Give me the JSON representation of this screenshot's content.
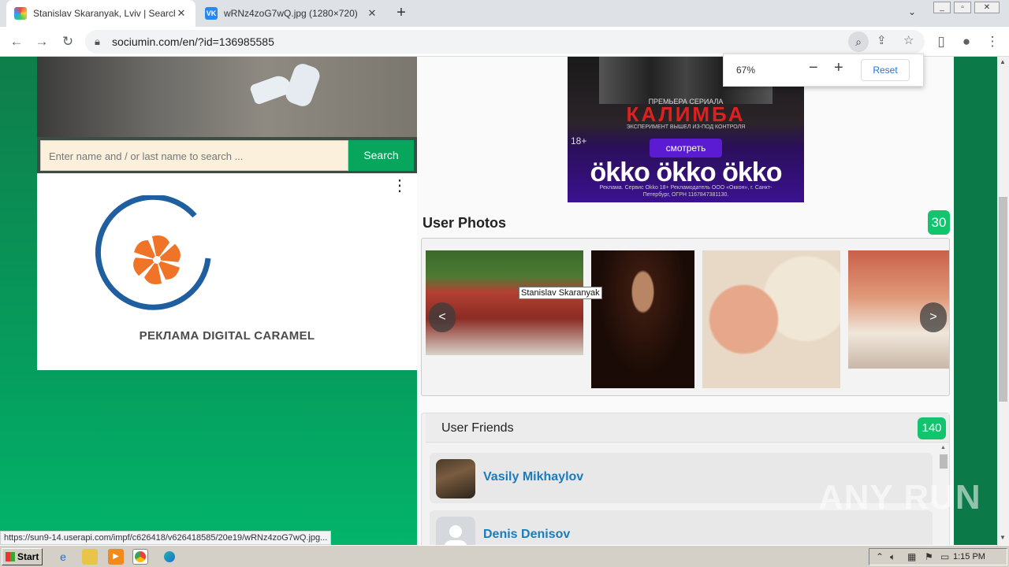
{
  "browser": {
    "tabs": [
      {
        "title": "Stanislav Skaranyak, Lviv | Search In",
        "active": true
      },
      {
        "title": "wRNz4zoG7wQ.jpg (1280×720)",
        "active": false
      }
    ],
    "new_tab": "+",
    "url": "sociumin.com/en/?id=136985585",
    "zoom_popup": {
      "level": "67%",
      "minus": "−",
      "plus": "+",
      "reset": "Reset"
    },
    "status_url": "https://sun9-14.userapi.com/impf/c626418/v626418585/20e19/wRNz4zoG7wQ.jpg..."
  },
  "search": {
    "placeholder": "Enter name and / or last name to search ...",
    "button": "Search"
  },
  "ad_left": {
    "brand": "РЕКЛАМА DIGITAL CARAMEL",
    "menu": "⋮"
  },
  "ad_okko": {
    "premiere": "ПРЕМЬЕРА СЕРИАЛА",
    "title": "КАЛИМБА",
    "subtitle": "ЭКСПЕРИМЕНТ ВЫШЕЛ ИЗ-ПОД КОНТРОЛЯ",
    "age": "18+",
    "watch": "смотреть",
    "logos": "ökko ökko ökko",
    "legal": "Реклама. Сервис Okko 18+ Рекламодатель ООО «Оккон», г. Санкт-Петербург, ОГРН 1167847381130."
  },
  "photos": {
    "title": "User Photos",
    "count": "30",
    "tooltip": "Stanislav Skaranyak",
    "prev": "<",
    "next": ">"
  },
  "friends": {
    "title": "User Friends",
    "count": "140",
    "items": [
      {
        "name": "Vasily Mikhaylov"
      },
      {
        "name": "Denis Denisov"
      }
    ]
  },
  "watermark": "ANY RUN",
  "taskbar": {
    "start": "Start",
    "clock": "1:15 PM"
  },
  "colors": {
    "accent_green": "#07a65c",
    "badge_green": "#12c46e",
    "link_blue": "#1a7bbd"
  }
}
